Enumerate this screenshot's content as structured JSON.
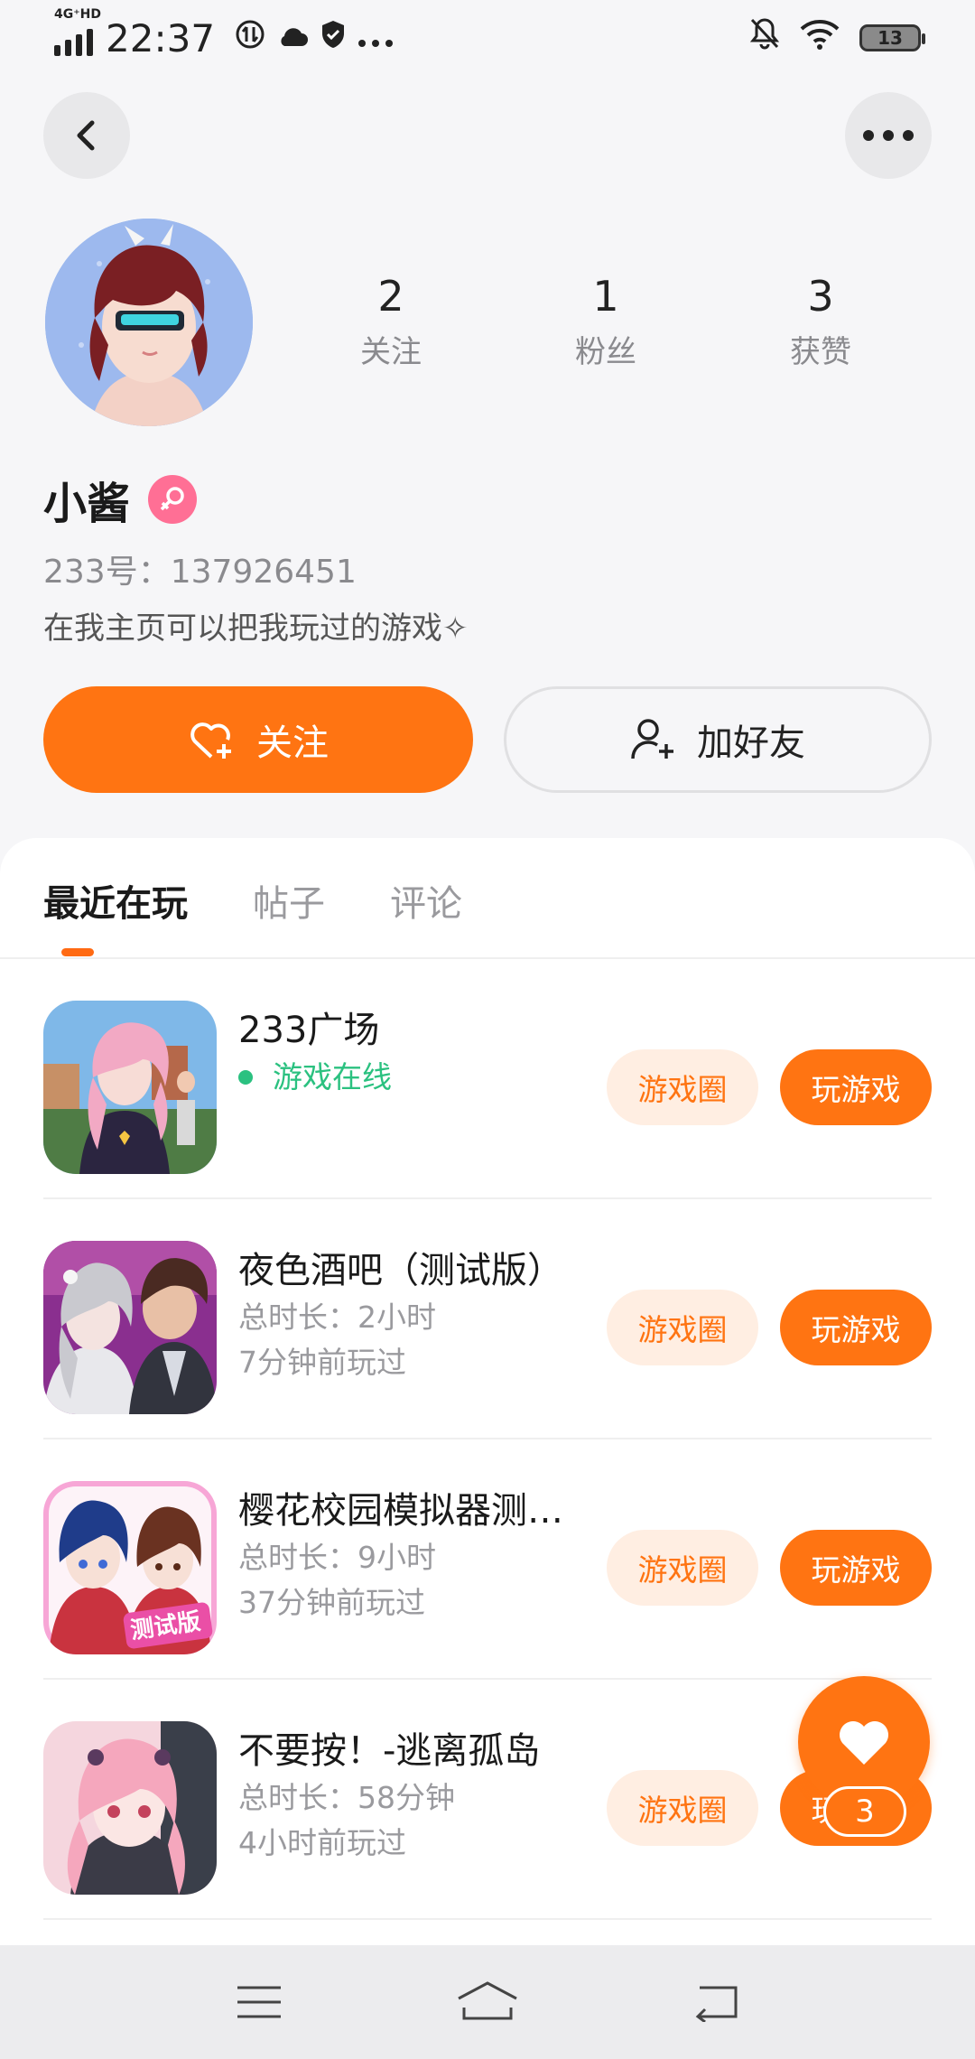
{
  "status_bar": {
    "network": "4G⁺HD",
    "time": "22:37",
    "battery": "13"
  },
  "profile": {
    "stats": [
      {
        "value": "2",
        "label": "关注"
      },
      {
        "value": "1",
        "label": "粉丝"
      },
      {
        "value": "3",
        "label": "获赞"
      }
    ],
    "username": "小酱",
    "user_id": "233号：137926451",
    "bio": "在我主页可以把我玩过的游戏✧",
    "follow_label": "关注",
    "add_friend_label": "加好友"
  },
  "tabs": [
    {
      "label": "最近在玩",
      "active": true
    },
    {
      "label": "帖子",
      "active": false
    },
    {
      "label": "评论",
      "active": false
    }
  ],
  "games": [
    {
      "title": "233广场",
      "line1": "游戏在线",
      "line2": "",
      "online": true,
      "circle_label": "游戏圈",
      "play_label": "玩游戏"
    },
    {
      "title": "夜色酒吧（测试版）",
      "line1": "总时长：2小时",
      "line2": "7分钟前玩过",
      "online": false,
      "circle_label": "游戏圈",
      "play_label": "玩游戏"
    },
    {
      "title": "樱花校园模拟器测…",
      "line1": "总时长：9小时",
      "line2": "37分钟前玩过",
      "online": false,
      "circle_label": "游戏圈",
      "play_label": "玩游戏",
      "icon_text": "测试版"
    },
    {
      "title": "不要按！-逃离孤岛",
      "line1": "总时长：58分钟",
      "line2": "4小时前玩过",
      "online": false,
      "circle_label": "游戏圈",
      "play_label": "玩游戏"
    }
  ],
  "like_fab": {
    "count": "3"
  },
  "colors": {
    "accent": "#ff7412",
    "online": "#2bc180",
    "female": "#ff6f95"
  }
}
